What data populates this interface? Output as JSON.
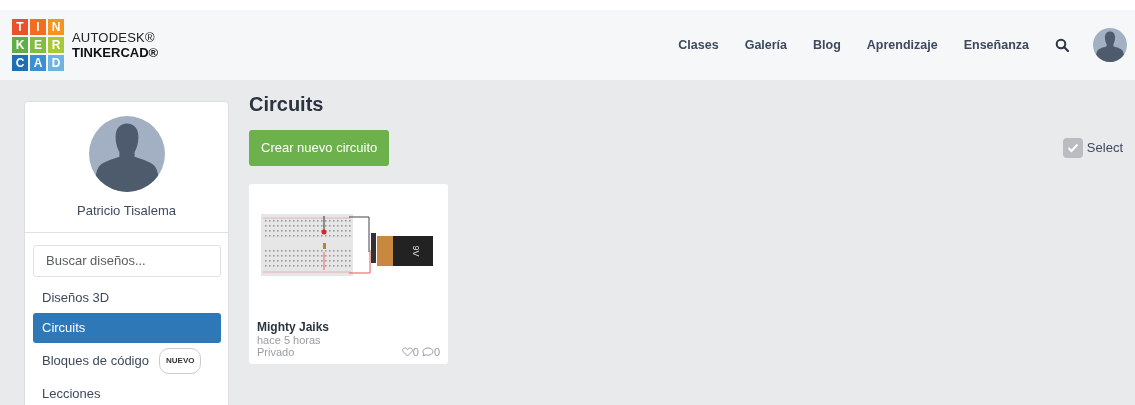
{
  "logo": {
    "tiles": [
      {
        "letter": "T",
        "color": "#e8512a"
      },
      {
        "letter": "I",
        "color": "#f26c22"
      },
      {
        "letter": "N",
        "color": "#f7941d"
      },
      {
        "letter": "K",
        "color": "#5fae46"
      },
      {
        "letter": "E",
        "color": "#82bd41"
      },
      {
        "letter": "R",
        "color": "#a9c837"
      },
      {
        "letter": "C",
        "color": "#1f6fb5"
      },
      {
        "letter": "A",
        "color": "#3b8fd2"
      },
      {
        "letter": "D",
        "color": "#6cb4e2"
      }
    ],
    "brand_top": "AUTODESK®",
    "brand_bottom": "TINKERCAD®"
  },
  "nav": {
    "links": [
      "Clases",
      "Galería",
      "Blog",
      "Aprendizaje",
      "Enseñanza"
    ]
  },
  "sidebar": {
    "user_name": "Patricio Tisalema",
    "search": {
      "placeholder": "Buscar diseños..."
    },
    "items": [
      {
        "label": "Diseños 3D",
        "selected": false
      },
      {
        "label": "Circuits",
        "selected": true
      },
      {
        "label": "Bloques de código",
        "selected": false,
        "badge": "NUEVO"
      },
      {
        "label": "Lecciones",
        "selected": false
      }
    ]
  },
  "main": {
    "title": "Circuits",
    "create_button": "Crear nuevo circuito",
    "select": {
      "label": "Select",
      "checked": true
    },
    "designs": [
      {
        "name": "Mighty Jaiks",
        "time": "hace 5 horas",
        "visibility": "Privado",
        "likes": "0",
        "comments": "0",
        "battery_label": "9V"
      }
    ]
  }
}
